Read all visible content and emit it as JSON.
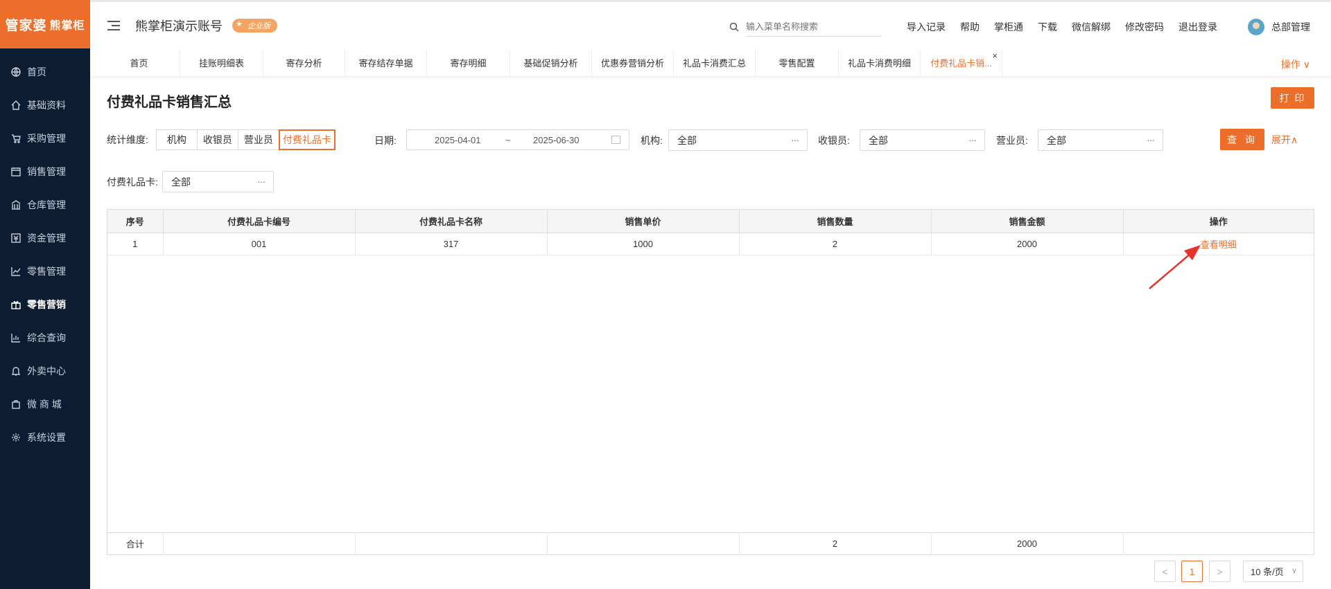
{
  "brand": {
    "logo_text": "管家婆",
    "logo_sub": "熊掌柜",
    "accent": "#ec6e2a",
    "sidebar_bg": "#0c1d33"
  },
  "sidebar": {
    "items": [
      {
        "label": "首页",
        "icon": "globe-icon",
        "active": false
      },
      {
        "label": "基础资料",
        "icon": "home-icon",
        "active": false
      },
      {
        "label": "采购管理",
        "icon": "cart-icon",
        "active": false
      },
      {
        "label": "销售管理",
        "icon": "calendar-icon",
        "active": false
      },
      {
        "label": "仓库管理",
        "icon": "warehouse-icon",
        "active": false
      },
      {
        "label": "资金管理",
        "icon": "money-icon",
        "active": false
      },
      {
        "label": "零售管理",
        "icon": "chart-icon",
        "active": false
      },
      {
        "label": "零售营销",
        "icon": "gift-icon",
        "active": true
      },
      {
        "label": "综合查询",
        "icon": "bar-chart-icon",
        "active": false
      },
      {
        "label": "外卖中心",
        "icon": "bell-icon",
        "active": false
      },
      {
        "label": "微 商 城",
        "icon": "bag-icon",
        "active": false
      },
      {
        "label": "系统设置",
        "icon": "gear-icon",
        "active": false
      }
    ]
  },
  "header": {
    "title": "熊掌柜演示账号",
    "edition_badge": "企业版",
    "search_placeholder": "输入菜单名称搜索",
    "links": [
      "导入记录",
      "帮助",
      "掌柜通",
      "下载",
      "微信解绑",
      "修改密码",
      "退出登录"
    ],
    "user_name": "总部管理"
  },
  "tabs": {
    "items": [
      "首页",
      "挂账明细表",
      "寄存分析",
      "寄存结存单据",
      "寄存明细",
      "基础促销分析",
      "优惠券营销分析",
      "礼品卡消费汇总",
      "零售配置",
      "礼品卡消费明细",
      "付费礼品卡销..."
    ],
    "active_index": 10,
    "ops_label": "操作 ∨"
  },
  "page": {
    "title": "付费礼品卡销售汇总",
    "print_label": "打 印"
  },
  "filters": {
    "dimension_label": "统计维度:",
    "dimension_options": [
      "机构",
      "收银员",
      "营业员",
      "付费礼品卡"
    ],
    "dimension_selected": 3,
    "date_label": "日期:",
    "date_start": "2025-04-01",
    "date_sep": "~",
    "date_end": "2025-06-30",
    "org_label": "机构:",
    "org_value": "全部",
    "cashier_label": "收银员:",
    "cashier_value": "全部",
    "clerk_label": "营业员:",
    "clerk_value": "全部",
    "card_label": "付费礼品卡:",
    "card_value": "全部",
    "dots": "···",
    "query_label": "查 询",
    "expand_label": "展开∧"
  },
  "table": {
    "columns": [
      "序号",
      "付费礼品卡编号",
      "付费礼品卡名称",
      "销售单价",
      "销售数量",
      "销售金额",
      "操作"
    ],
    "rows": [
      {
        "index": "1",
        "code": "001",
        "name": "317",
        "price": "1000",
        "qty": "2",
        "amount": "2000",
        "action": "查看明细"
      }
    ],
    "summary": {
      "label": "合计",
      "qty": "2",
      "amount": "2000"
    }
  },
  "pagination": {
    "prev": "<",
    "current": "1",
    "next": ">",
    "page_size": "10 条/页"
  }
}
